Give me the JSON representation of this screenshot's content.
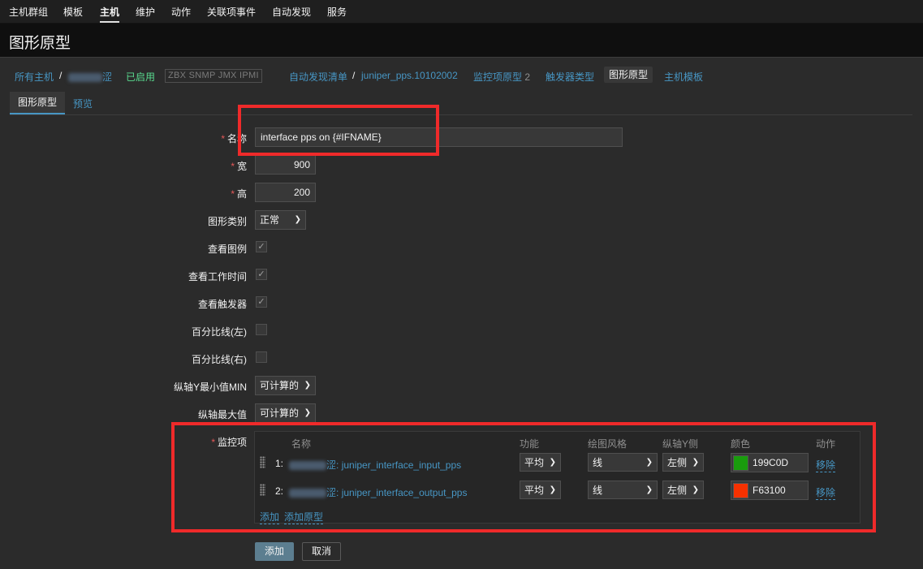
{
  "nav": {
    "items": [
      "主机群组",
      "模板",
      "主机",
      "维护",
      "动作",
      "关联项事件",
      "自动发现",
      "服务"
    ],
    "active": "主机"
  },
  "header": {
    "title": "图形原型"
  },
  "breadcrumb": {
    "all_hosts": "所有主机",
    "sep": "/",
    "host_suffix": "涩",
    "enabled": "已启用",
    "interfaces": "ZBX SNMP JMX IPMI",
    "discovery_list": "自动发现清单",
    "discovery_rule": "juniper_pps.10102002",
    "item_prototypes": "监控项原型",
    "item_prototypes_count": "2",
    "trigger_prototypes": "触发器类型",
    "graph_prototypes": "图形原型",
    "host_templates": "主机模板"
  },
  "tabs": [
    {
      "label": "图形原型",
      "active": true
    },
    {
      "label": "预览",
      "active": false
    }
  ],
  "form": {
    "required_mark": "*",
    "name_label": "名称",
    "name_value": "interface  pps  on {#IFNAME}",
    "width_label": "宽",
    "width_value": "900",
    "height_label": "高",
    "height_value": "200",
    "graph_type_label": "图形类别",
    "graph_type_value": "正常",
    "show_legend_label": "查看图例",
    "show_legend": true,
    "show_working_time_label": "查看工作时间",
    "show_working_time": true,
    "show_triggers_label": "查看触发器",
    "show_triggers": true,
    "percentile_left_label": "百分比线(左)",
    "percentile_left": false,
    "percentile_right_label": "百分比线(右)",
    "percentile_right": false,
    "ymin_label": "纵轴Y最小值MIN",
    "ymin_value": "可计算的",
    "ymax_label": "纵轴最大值",
    "ymax_value": "可计算的",
    "items_label": "监控项"
  },
  "items": {
    "headers": [
      "名称",
      "功能",
      "绘图风格",
      "纵轴Y侧",
      "颜色",
      "动作"
    ],
    "rows": [
      {
        "index": "1:",
        "host_suffix": "涩:",
        "name": "juniper_interface_input_pps",
        "function": "平均",
        "draw_style": "线",
        "y_axis": "左侧",
        "color": "199C0D",
        "color_hex": "#199C0D",
        "action": "移除"
      },
      {
        "index": "2:",
        "host_suffix": "涩:",
        "name": "juniper_interface_output_pps",
        "function": "平均",
        "draw_style": "线",
        "y_axis": "左侧",
        "color": "F63100",
        "color_hex": "#F63100",
        "action": "移除"
      }
    ],
    "add_link": "添加",
    "add_prototype_link": "添加原型"
  },
  "buttons": {
    "add": "添加",
    "cancel": "取消"
  },
  "colors": {
    "accent": "#4796c4",
    "highlight": "#ef2a2a",
    "enabled": "#59db8f"
  }
}
